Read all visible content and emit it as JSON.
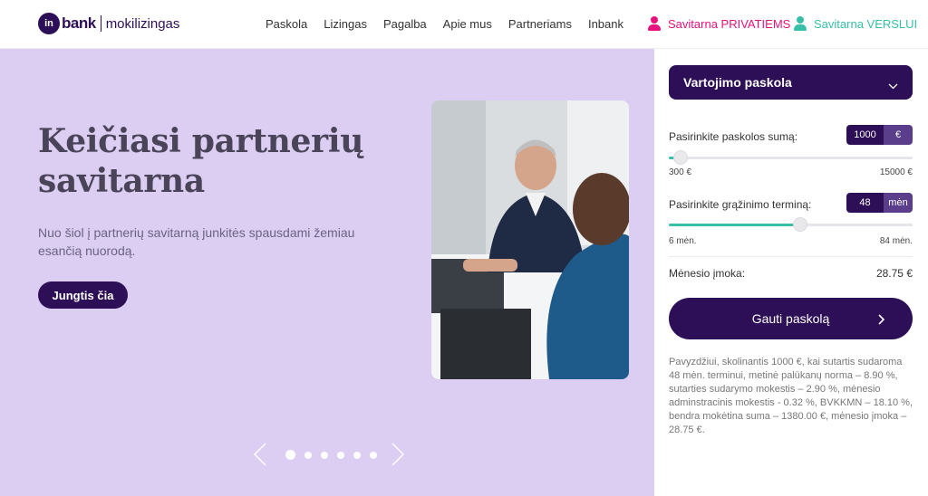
{
  "logo": {
    "mark": "in",
    "brand": "bank",
    "sub": "mokilizingas"
  },
  "nav": [
    "Paskola",
    "Lizingas",
    "Pagalba",
    "Apie mus",
    "Partneriams",
    "Inbank"
  ],
  "portals": {
    "private": "Savitarna PRIVATIEMS",
    "business": "Savitarna VERSLUI"
  },
  "hero": {
    "title": "Keičiasi partnerių savitarna",
    "subtitle": "Nuo šiol į partnerių savitarną junkitės spausdami žemiau esančią nuorodą.",
    "cta": "Jungtis čia"
  },
  "carousel": {
    "slides": 6,
    "active": 0
  },
  "calculator": {
    "product": "Vartojimo paskola",
    "amount": {
      "label": "Pasirinkite paskolos sumą:",
      "value": "1000",
      "unit": "€",
      "min": "300 €",
      "max": "15000 €",
      "fraction": 0.05
    },
    "term": {
      "label": "Pasirinkite grąžinimo terminą:",
      "value": "48",
      "unit": "mėn",
      "min": "6 mėn.",
      "max": "84 mėn.",
      "fraction": 0.54
    },
    "monthly": {
      "label": "Mėnesio įmoka:",
      "value": "28.75 €"
    },
    "apply": "Gauti paskolą",
    "disclaimer": "Pavyzdžiui, skolinantis 1000 €, kai sutartis sudaroma 48 mėn. terminui, metinė palūkanų norma – 8.90 %, sutarties sudarymo mokestis – 2.90 %, mėnesio adminstracinis mokestis - 0.32 %, BVKKMN – 18.10 %, bendra mokėtina suma – 1380.00 €, mėnesio įmoka – 28.75 €."
  },
  "colors": {
    "brand": "#2d0f57",
    "hero_bg": "#dccdf3",
    "private": "#e6127d",
    "business": "#38bfa7",
    "accent": "#38bfa7"
  }
}
